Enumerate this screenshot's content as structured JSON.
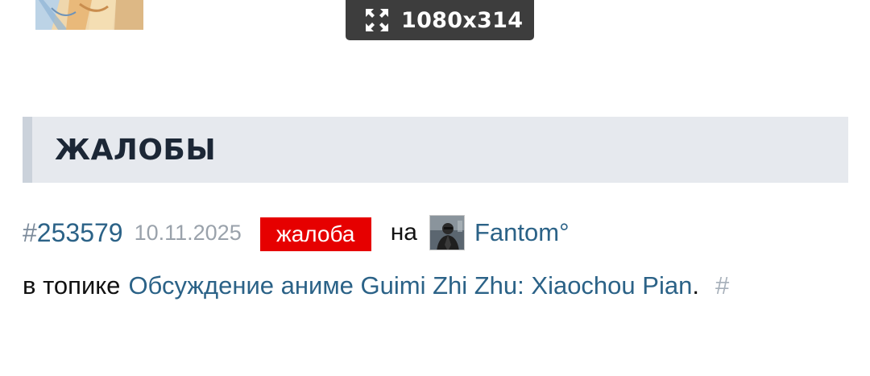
{
  "image_badge": {
    "icon": "expand-icon",
    "dimensions_text": "1080x314"
  },
  "section": {
    "title": "ЖАЛОБЫ"
  },
  "complaint": {
    "hash_prefix": "#",
    "id": "253579",
    "date": "10.11.2025",
    "type_badge": "жалоба",
    "type_badge_color": "#e60000",
    "on_word": "на",
    "user_avatar_icon": "user-avatar",
    "username": "Fantom°",
    "topic_prefix": "в топике",
    "topic_title": "Обсуждение аниме Guimi Zhi Zhu: Xiaochou Pian",
    "topic_suffix": ".",
    "anchor_hash": "#"
  },
  "colors": {
    "link": "#2b6287",
    "header_bg": "#e6e9ee",
    "header_border": "#cbd2db",
    "badge_bg": "#3d3d3d"
  }
}
